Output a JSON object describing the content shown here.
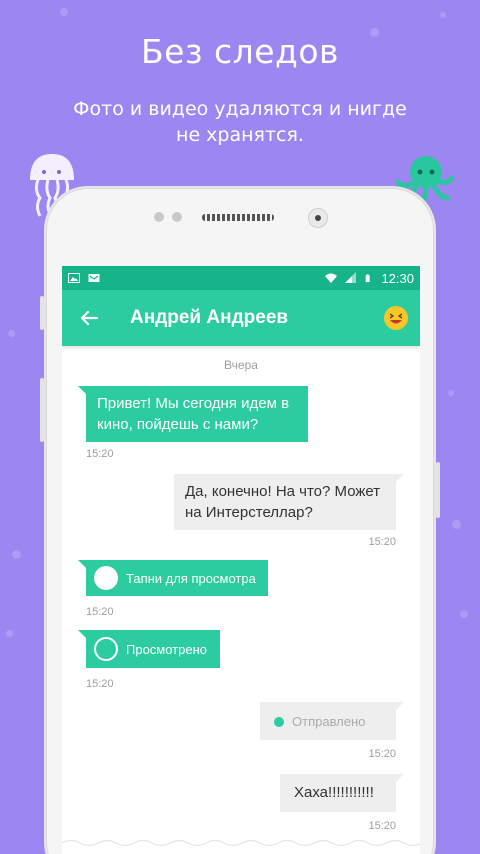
{
  "promo": {
    "title": "Без следов",
    "subtitle": "Фото и видео удаляются и нигде не хранятся."
  },
  "colors": {
    "background": "#9b86f2",
    "accent": "#2ccba0",
    "status_bar": "#17b38a"
  },
  "status_bar": {
    "icons": [
      "image-icon",
      "mail-check-icon",
      "wifi-icon",
      "signal-icon",
      "battery-icon"
    ],
    "time": "12:30"
  },
  "toolbar": {
    "back_icon": "arrow-left-icon",
    "contact_name": "Андрей Андреев",
    "emoji_icon": "laughing-emoji-icon"
  },
  "chat": {
    "date_label": "Вчера",
    "messages": [
      {
        "direction": "in",
        "kind": "text",
        "text": "Привет! Мы сегодня идем в кино, пойдешь с нами?",
        "time": "15:20"
      },
      {
        "direction": "out",
        "kind": "text",
        "text": "Да, конечно! На что? Может на Интерстеллар?",
        "time": "15:20"
      },
      {
        "direction": "in",
        "kind": "media",
        "text": "Тапни для просмотра",
        "time": "15:20"
      },
      {
        "direction": "in",
        "kind": "media",
        "text": "Просмотрено",
        "time": "15:20"
      },
      {
        "direction": "out",
        "kind": "media",
        "text": "Отправлено",
        "time": "15:20"
      },
      {
        "direction": "out",
        "kind": "text",
        "text": "Хаха!!!!!!!!!!!",
        "time": "15:20"
      }
    ]
  }
}
